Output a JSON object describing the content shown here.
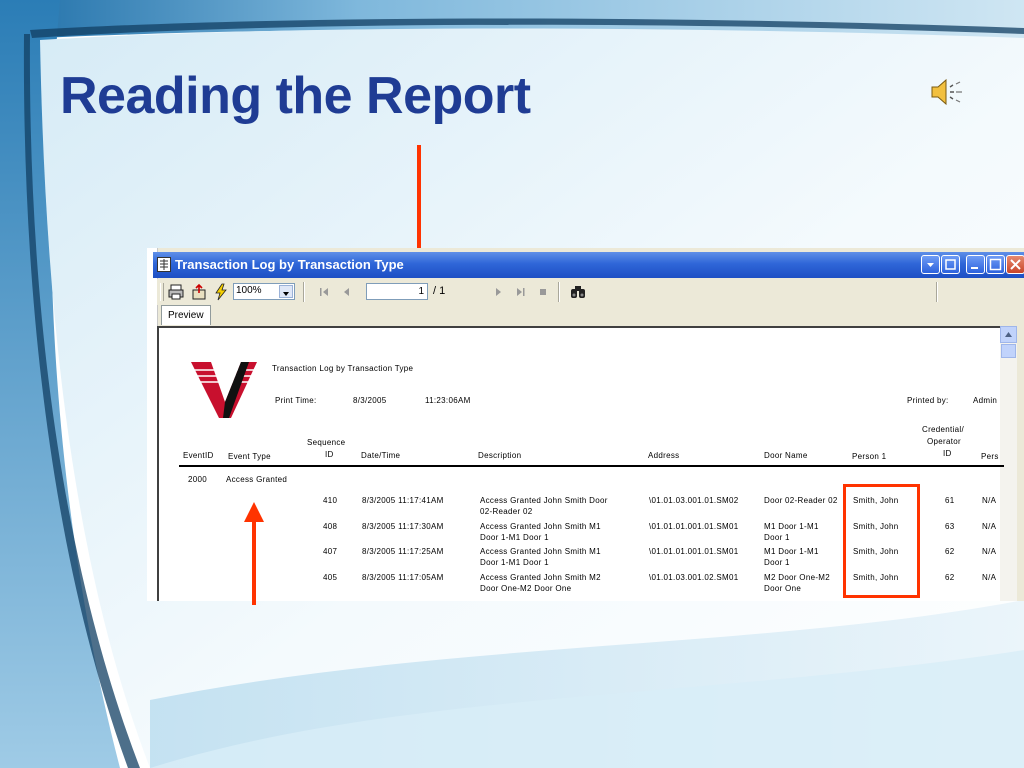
{
  "slide": {
    "title": "Reading the Report"
  },
  "window": {
    "title": "Transaction Log by Transaction Type"
  },
  "toolbar": {
    "zoom": "100%",
    "page_current": "1",
    "page_total": "/ 1"
  },
  "tab": {
    "label": "Preview"
  },
  "report": {
    "heading": "Transaction Log by Transaction Type",
    "print_time_label": "Print Time:",
    "print_date": "8/3/2005",
    "print_clock": "11:23:06AM",
    "printed_by_label": "Printed by:",
    "printed_by_value": "Admin",
    "columns": {
      "event_id": "EventID",
      "event_type": "Event Type",
      "seq_1": "Sequence",
      "seq_2": "ID",
      "datetime": "Date/Time",
      "description": "Description",
      "address": "Address",
      "door_name": "Door Name",
      "person1": "Person 1",
      "cred_1": "Credential/",
      "cred_2": "Operator",
      "cred_3": "ID",
      "pers": "Pers"
    },
    "group": {
      "event_id": "2000",
      "event_type": "Access Granted"
    },
    "rows": [
      {
        "seq": "410",
        "datetime": "8/3/2005  11:17:41AM",
        "desc1": "Access Granted John Smith  Door",
        "desc2": "02-Reader 02",
        "address": "\\01.01.03.001.01.SM02",
        "door1": "Door 02-Reader 02",
        "door2": "",
        "person": "Smith, John",
        "cred": "61",
        "pers": "N/A"
      },
      {
        "seq": "408",
        "datetime": "8/3/2005  11:17:30AM",
        "desc1": "Access Granted John Smith  M1",
        "desc2": "Door 1-M1 Door 1",
        "address": "\\01.01.01.001.01.SM01",
        "door1": "M1 Door 1-M1",
        "door2": "Door 1",
        "person": "Smith, John",
        "cred": "63",
        "pers": "N/A"
      },
      {
        "seq": "407",
        "datetime": "8/3/2005  11:17:25AM",
        "desc1": "Access Granted John Smith  M1",
        "desc2": "Door 1-M1 Door 1",
        "address": "\\01.01.01.001.01.SM01",
        "door1": "M1 Door 1-M1",
        "door2": "Door 1",
        "person": "Smith, John",
        "cred": "62",
        "pers": "N/A"
      },
      {
        "seq": "405",
        "datetime": "8/3/2005  11:17:05AM",
        "desc1": "Access Granted John Smith  M2",
        "desc2": "Door One-M2 Door One",
        "address": "\\01.01.03.001.02.SM01",
        "door1": "M2 Door One-M2",
        "door2": "Door One",
        "person": "Smith, John",
        "cred": "62",
        "pers": "N/A"
      }
    ]
  },
  "colors": {
    "title": "#1f3c94",
    "annotation": "#ff3300",
    "titlebar": "#2f66d8"
  }
}
